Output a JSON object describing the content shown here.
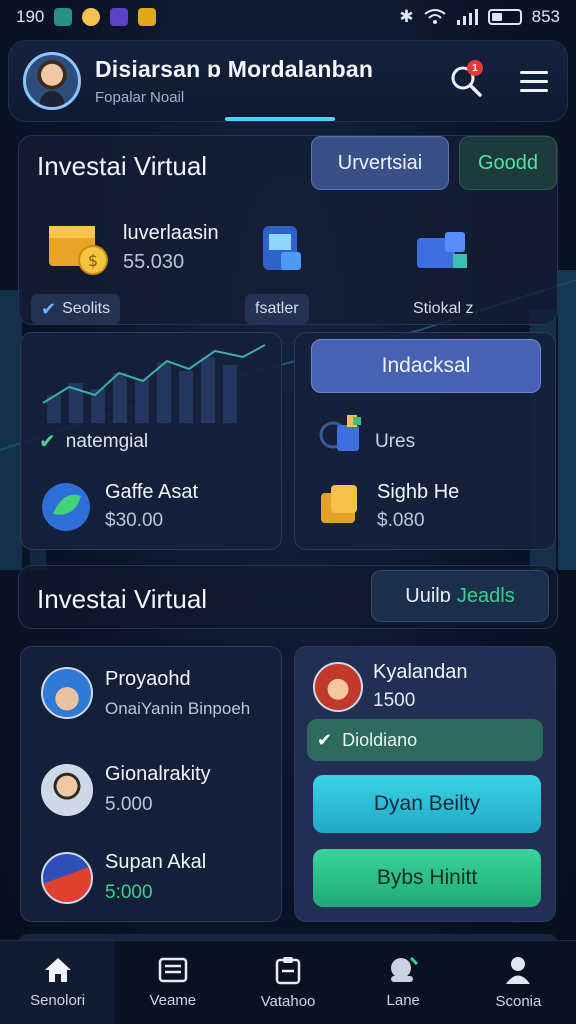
{
  "status_bar": {
    "time": "190",
    "battery_text": "853"
  },
  "header": {
    "title": "Disiarsan ɒ Mordalanban",
    "subtitle": "Fopalar Noail",
    "notification_count": "1"
  },
  "section1": {
    "title": "Investai Virtual",
    "btn_primary": "Urvertsiai",
    "btn_secondary": "Goodd",
    "asset": {
      "name": "luverlaasin",
      "value": "55.030"
    },
    "tags": [
      "Seolits",
      "fsatler",
      "Stiokal z"
    ]
  },
  "card_left": {
    "check_label": "natemgial",
    "asset": {
      "name": "Gaffe Asat",
      "value": "$30.00"
    }
  },
  "card_right": {
    "button": "Indacksal",
    "label": "Ures",
    "asset": {
      "name": "Sighb He",
      "value": "$.080"
    }
  },
  "section2": {
    "title": "Investai Virtual",
    "btn_a": "Uuilɒ",
    "btn_b": "Jeadls"
  },
  "people": [
    {
      "name": "Proyaohd",
      "sub": "OnaiYanin Binpoeh"
    },
    {
      "name": "Gionalrakity",
      "sub": "5.000"
    },
    {
      "name": "Supan Akal",
      "sub": "5:000"
    }
  ],
  "right_panel": {
    "name": "Kyalandan",
    "value": "1500",
    "check_label": "Dioldiano",
    "btn1": "Dyan Beilty",
    "btn2": "Bybs Hinitt"
  },
  "nav": [
    "Senolori",
    "Veame",
    "Vatahoo",
    "Lane",
    "Sconia"
  ],
  "colors": {
    "accent": "#4fd1ff",
    "success": "#3ccf8e",
    "primary_btn": "#3f5ca8"
  }
}
